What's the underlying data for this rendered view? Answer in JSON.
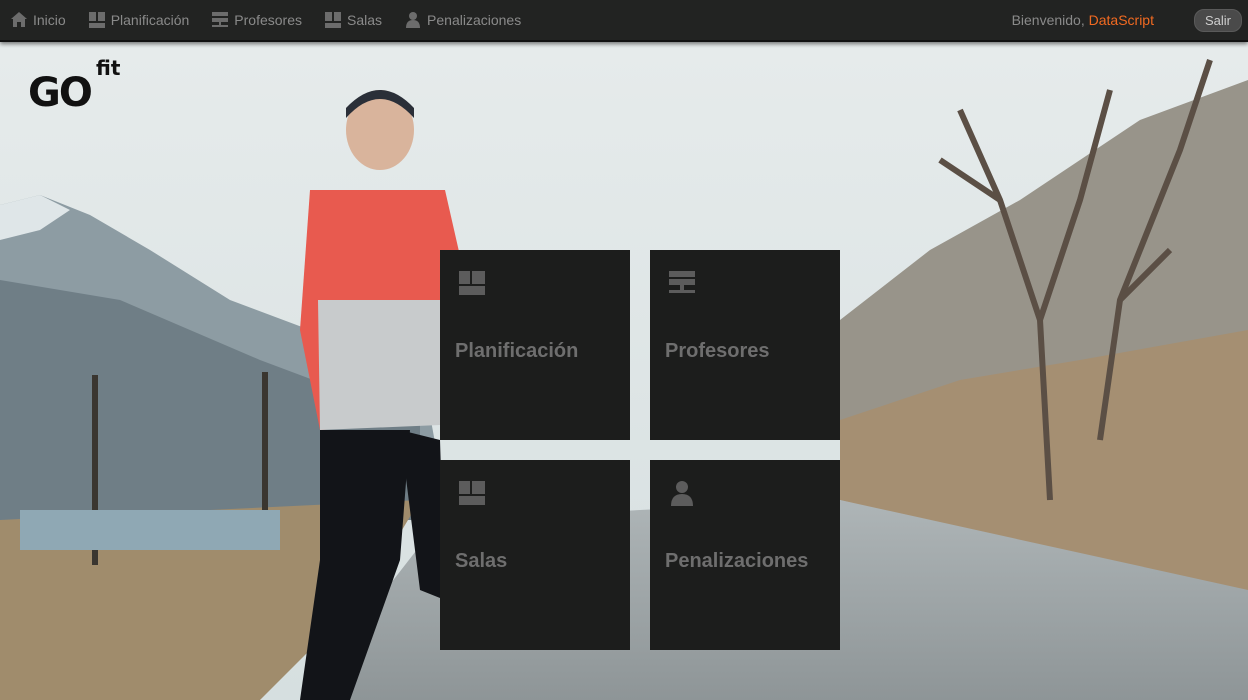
{
  "nav": {
    "items": [
      {
        "label": "Inicio",
        "icon": "home-icon"
      },
      {
        "label": "Planificación",
        "icon": "grid-icon"
      },
      {
        "label": "Profesores",
        "icon": "network-icon"
      },
      {
        "label": "Salas",
        "icon": "grid-icon"
      },
      {
        "label": "Penalizaciones",
        "icon": "user-icon"
      }
    ],
    "welcome": "Bienvenido, ",
    "username": "DataScript",
    "logout_label": "Salir"
  },
  "logo": {
    "main": "GO",
    "sup": "fit"
  },
  "tiles": [
    {
      "label": "Planificación",
      "icon": "grid-icon"
    },
    {
      "label": "Profesores",
      "icon": "network-icon"
    },
    {
      "label": "Salas",
      "icon": "grid-icon"
    },
    {
      "label": "Penalizaciones",
      "icon": "user-icon"
    }
  ],
  "colors": {
    "navbar": "#222322",
    "tile": "#1c1d1c",
    "accent": "#f26a21",
    "nav_text": "#8a8a8a",
    "tile_text": "#6e6e6e"
  }
}
